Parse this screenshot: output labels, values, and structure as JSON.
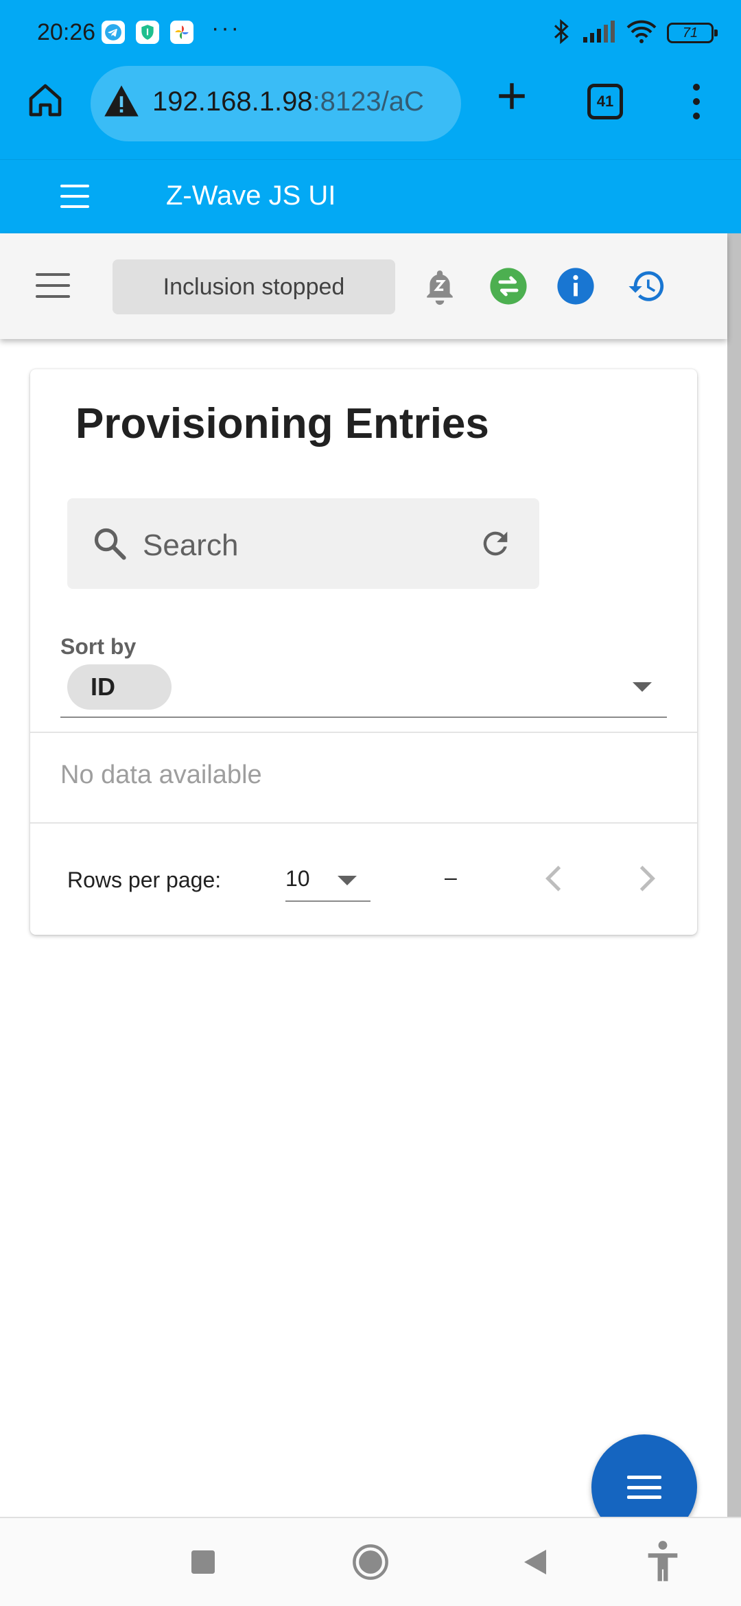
{
  "status_bar": {
    "time": "20:26",
    "battery": "71",
    "icons": [
      "telegram-icon",
      "shield-app-icon",
      "pinwheel-app-icon",
      "more-dots-icon",
      "bluetooth-icon",
      "signal-icon",
      "wifi-icon",
      "battery-icon"
    ],
    "dots": "···"
  },
  "browser": {
    "url_host": "192.168.1.98",
    "url_rest": ":8123/aC",
    "tab_count": "41",
    "icons": [
      "home-icon",
      "warning-icon",
      "plus-icon",
      "tabs-icon",
      "more-vert-icon"
    ]
  },
  "app_bar": {
    "title": "Z-Wave JS UI"
  },
  "toolbar": {
    "inclusion_status": "Inclusion stopped",
    "icons": [
      "menu-icon",
      "bell-z-icon",
      "swap-icon",
      "info-icon",
      "history-icon"
    ],
    "colors": {
      "swap": "#4caf50",
      "info": "#1976d2",
      "history": "#1976d2"
    }
  },
  "card": {
    "title": "Provisioning Entries",
    "search_placeholder": "Search",
    "sort_label": "Sort by",
    "sort_value": "ID",
    "empty_text": "No data available",
    "rows_per_page_label": "Rows per page:",
    "rows_per_page_value": "10",
    "page_range": "–"
  },
  "colors": {
    "primary": "#03a9f4",
    "fab": "#1565c0"
  }
}
